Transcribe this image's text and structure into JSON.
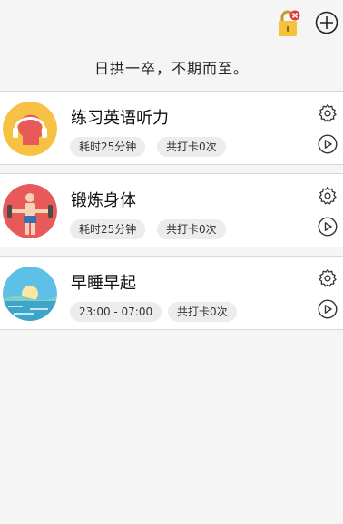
{
  "header": {
    "lock_icon": "lock-icon",
    "add_icon": "plus-circle-icon",
    "motto": "日拱一卒，不期而至。"
  },
  "habits": [
    {
      "icon": "headphones-icon",
      "title": "练习英语听力",
      "chip1": "耗时25分钟",
      "chip2": "共打卡0次",
      "accent": "#f7c243"
    },
    {
      "icon": "exercise-icon",
      "title": "锻炼身体",
      "chip1": "耗时25分钟",
      "chip2": "共打卡0次",
      "accent": "#e85a5a"
    },
    {
      "icon": "sunrise-icon",
      "title": "早睡早起",
      "chip1": "23:00 - 07:00",
      "chip2": "共打卡0次",
      "accent": "#5ec0e6"
    }
  ],
  "colors": {
    "background": "#f5f5f5",
    "card": "#ffffff",
    "chip": "#ececec",
    "lock_yellow": "#f6c13c",
    "badge_red": "#e53935"
  }
}
